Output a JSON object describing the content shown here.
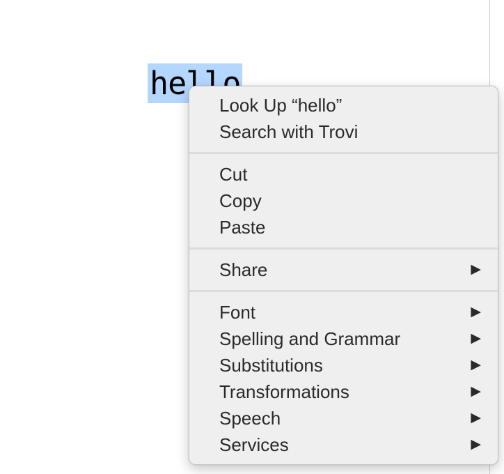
{
  "document": {
    "selected_text": "hello"
  },
  "context_menu": {
    "groups": [
      {
        "items": [
          {
            "label": "Look Up “hello”",
            "has_submenu": false
          },
          {
            "label": "Search with Trovi",
            "has_submenu": false
          }
        ]
      },
      {
        "items": [
          {
            "label": "Cut",
            "has_submenu": false
          },
          {
            "label": "Copy",
            "has_submenu": false
          },
          {
            "label": "Paste",
            "has_submenu": false
          }
        ]
      },
      {
        "items": [
          {
            "label": "Share",
            "has_submenu": true
          }
        ]
      },
      {
        "items": [
          {
            "label": "Font",
            "has_submenu": true
          },
          {
            "label": "Spelling and Grammar",
            "has_submenu": true
          },
          {
            "label": "Substitutions",
            "has_submenu": true
          },
          {
            "label": "Transformations",
            "has_submenu": true
          },
          {
            "label": "Speech",
            "has_submenu": true
          },
          {
            "label": "Services",
            "has_submenu": true
          }
        ]
      }
    ],
    "submenu_arrow_glyph": "▶"
  },
  "colors": {
    "selection_highlight": "#b4d7ff",
    "menu_background": "#efefef",
    "menu_text": "#2a2a2a"
  }
}
